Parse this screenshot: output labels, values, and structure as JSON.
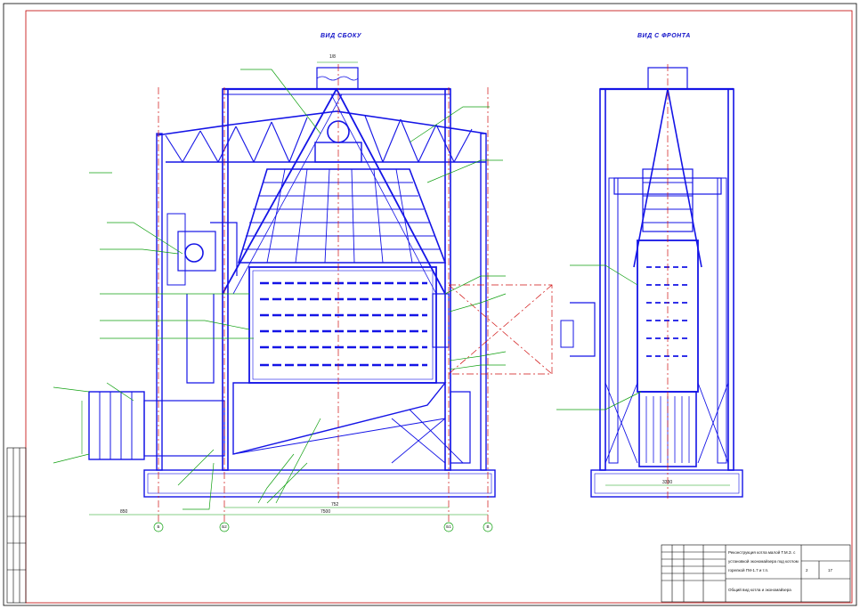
{
  "views": {
    "side": {
      "title": "ВИД СБОКУ"
    },
    "front": {
      "title": "ВИД С ФРОНТА"
    }
  },
  "dimensions": {
    "side_total": "7500",
    "side_span": "752",
    "side_left": "850",
    "front_width": "3330",
    "chimney": "1/8"
  },
  "axes": [
    "Б",
    "Б2",
    "Б1",
    "В"
  ],
  "title_block": {
    "main_line_1": "Реконструкция котла малой Т.М.З. с",
    "main_line_2": "установкой экономайзера под котлом",
    "main_line_3": "горелкой ГМ-1.7 и т.п.",
    "drawing_name": "Общий вид котла и экономайзера",
    "sheet_no": "2",
    "sheets": "17"
  }
}
